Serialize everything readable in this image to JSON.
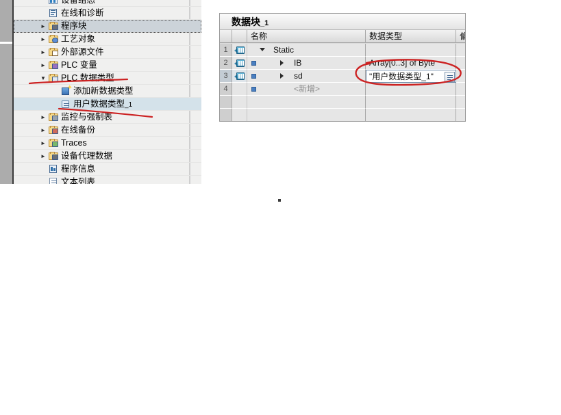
{
  "tree": {
    "name": "project-tree",
    "items": [
      {
        "label": "设备组态",
        "icon": "device-config-icon",
        "indent": 56,
        "expander": "",
        "state": "normal",
        "clipped": true
      },
      {
        "label": "在线和诊断",
        "icon": "online-diagnostics-icon",
        "indent": 56,
        "expander": "",
        "state": "normal"
      },
      {
        "label": "程序块",
        "icon": "program-blocks-folder-icon",
        "indent": 56,
        "expander": "right",
        "state": "focus"
      },
      {
        "label": "工艺对象",
        "icon": "technology-objects-folder-icon",
        "indent": 56,
        "expander": "right",
        "state": "normal"
      },
      {
        "label": "外部源文件",
        "icon": "external-source-files-folder-icon",
        "indent": 56,
        "expander": "right",
        "state": "normal"
      },
      {
        "label": "PLC 变量",
        "icon": "plc-tags-folder-icon",
        "indent": 56,
        "expander": "right",
        "state": "normal"
      },
      {
        "label": "PLC 数据类型",
        "icon": "plc-data-types-folder-icon",
        "indent": 56,
        "expander": "down",
        "state": "normal"
      },
      {
        "label": "添加新数据类型",
        "icon": "add-new-data-type-icon",
        "indent": 74,
        "expander": "",
        "state": "normal"
      },
      {
        "label": "用户数据类型_1",
        "icon": "user-data-type-icon",
        "indent": 74,
        "expander": "",
        "state": "selected"
      },
      {
        "label": "监控与强制表",
        "icon": "watch-force-tables-folder-icon",
        "indent": 56,
        "expander": "right",
        "state": "normal"
      },
      {
        "label": "在线备份",
        "icon": "online-backups-folder-icon",
        "indent": 56,
        "expander": "right",
        "state": "normal"
      },
      {
        "label": "Traces",
        "icon": "traces-folder-icon",
        "indent": 56,
        "expander": "right",
        "state": "normal"
      },
      {
        "label": "设备代理数据",
        "icon": "device-proxy-data-folder-icon",
        "indent": 56,
        "expander": "right",
        "state": "normal"
      },
      {
        "label": "程序信息",
        "icon": "program-info-icon",
        "indent": 56,
        "expander": "",
        "state": "normal"
      },
      {
        "label": "文本列表",
        "icon": "text-lists-icon",
        "indent": 56,
        "expander": "",
        "state": "normal",
        "clipped": true
      }
    ]
  },
  "data_block": {
    "title": "数据块_1",
    "columns": [
      {
        "key": "num",
        "label": ""
      },
      {
        "key": "icon",
        "label": ""
      },
      {
        "key": "name",
        "label": "名称"
      },
      {
        "key": "type",
        "label": "数据类型"
      },
      {
        "key": "offset",
        "label": "偏"
      }
    ],
    "rows": [
      {
        "num": "1",
        "tag": true,
        "bullet": false,
        "expander": "down",
        "name": "Static",
        "type": "",
        "editing": false
      },
      {
        "num": "2",
        "tag": true,
        "bullet": true,
        "expander": "right",
        "name": "IB",
        "type": "Array[0..3] of Byte",
        "editing": false
      },
      {
        "num": "3",
        "tag": true,
        "bullet": true,
        "expander": "right",
        "name": "sd",
        "type": "\"用户数据类型_1\"",
        "editing": true,
        "highlight": true
      },
      {
        "num": "4",
        "tag": false,
        "bullet": true,
        "expander": "",
        "name": "<新增>",
        "type": "",
        "editing": false,
        "placeholder": true
      },
      {
        "num": "",
        "tag": false,
        "bullet": false,
        "expander": "",
        "name": "",
        "type": "",
        "editing": false
      },
      {
        "num": "",
        "tag": false,
        "bullet": false,
        "expander": "",
        "name": "",
        "type": "",
        "editing": false
      }
    ],
    "type_picker_icon": "data-type-picker-icon"
  },
  "annotations": {
    "color": "#cc2222",
    "marks": [
      {
        "name": "underline-plc-data-types",
        "kind": "underline"
      },
      {
        "name": "underline-user-data-type-1",
        "kind": "underline"
      },
      {
        "name": "circle-data-type-cell",
        "kind": "ellipse"
      }
    ]
  }
}
